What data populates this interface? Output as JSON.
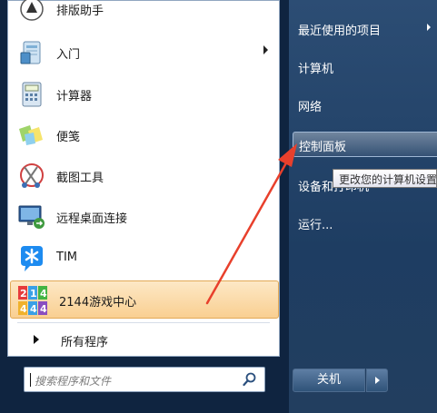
{
  "left": {
    "items": [
      {
        "label": "排版助手",
        "icon": "typeset-assistant-icon"
      },
      {
        "label": "入门",
        "icon": "getting-started-icon",
        "submenu": true
      },
      {
        "label": "计算器",
        "icon": "calculator-icon"
      },
      {
        "label": "便笺",
        "icon": "sticky-notes-icon"
      },
      {
        "label": "截图工具",
        "icon": "snipping-tool-icon"
      },
      {
        "label": "远程桌面连接",
        "icon": "remote-desktop-icon"
      },
      {
        "label": "TIM",
        "icon": "tim-icon"
      },
      {
        "label": "2144游戏中心",
        "icon": "game-center-icon",
        "highlighted": true
      }
    ],
    "all_programs": "所有程序",
    "search_placeholder": "搜索程序和文件"
  },
  "right": {
    "items": [
      {
        "label": "最近使用的项目",
        "submenu": true
      },
      {
        "label": "计算机"
      },
      {
        "label": "网络"
      },
      {
        "label": "控制面板",
        "active": true
      },
      {
        "label": "设备和打印机"
      },
      {
        "label": "运行..."
      }
    ],
    "tooltip": "更改您的计算机设置",
    "shutdown_label": "关机"
  },
  "colors": {
    "highlight_top": "#fde8c6",
    "highlight_bottom": "#f9cf91",
    "annotation_arrow": "#e8402c"
  }
}
